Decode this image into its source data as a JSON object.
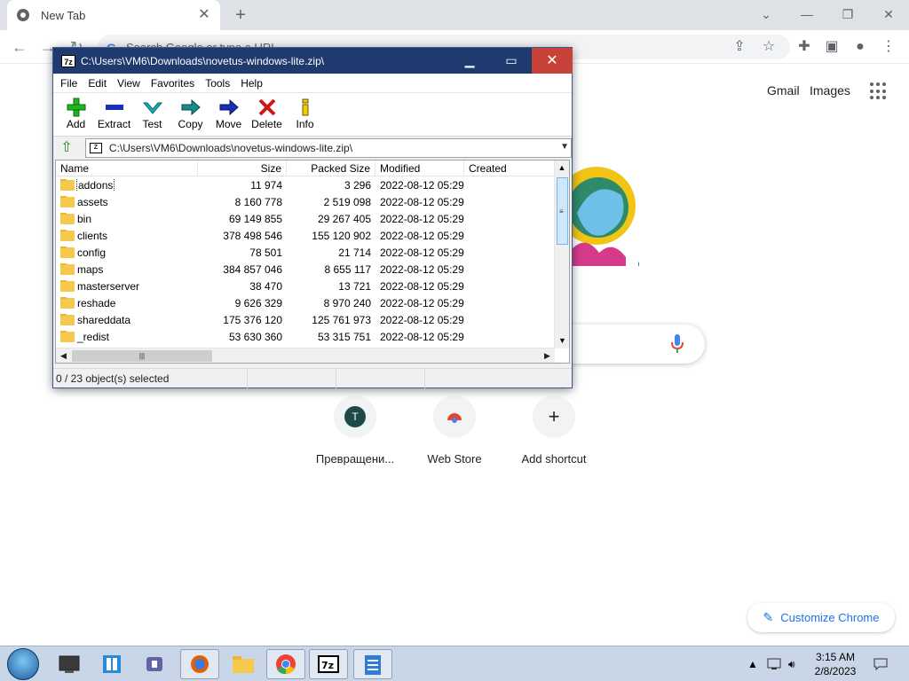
{
  "chrome": {
    "tab_title": "New Tab",
    "omnibox_placeholder": "Search Google or type a URL",
    "header_links": [
      "Gmail",
      "Images"
    ],
    "shortcuts": [
      {
        "label": "Превращени...",
        "initial": "T"
      },
      {
        "label": "Web Store"
      },
      {
        "label": "Add shortcut"
      }
    ],
    "customize_label": "Customize Chrome"
  },
  "zip": {
    "title": "C:\\Users\\VM6\\Downloads\\novetus-windows-lite.zip\\",
    "app_icon_text": "7z",
    "menu": [
      "File",
      "Edit",
      "View",
      "Favorites",
      "Tools",
      "Help"
    ],
    "toolbar": [
      {
        "label": "Add",
        "icon": "plus-icon",
        "color": "#1fb51f"
      },
      {
        "label": "Extract",
        "icon": "minus-icon",
        "color": "#1a2fb8"
      },
      {
        "label": "Test",
        "icon": "check-icon",
        "color": "#1ab0b8"
      },
      {
        "label": "Copy",
        "icon": "arrow-right-icon",
        "color": "#1a8a8a"
      },
      {
        "label": "Move",
        "icon": "arrow-right-icon",
        "color": "#1a2fb8"
      },
      {
        "label": "Delete",
        "icon": "x-icon",
        "color": "#d01818"
      },
      {
        "label": "Info",
        "icon": "info-icon",
        "color": "#c8a000"
      }
    ],
    "address": "C:\\Users\\VM6\\Downloads\\novetus-windows-lite.zip\\",
    "columns": [
      "Name",
      "Size",
      "Packed Size",
      "Modified",
      "Created"
    ],
    "rows": [
      {
        "name": "addons",
        "size": "11 974",
        "packed": "3 296",
        "modified": "2022-08-12 05:29",
        "created": ""
      },
      {
        "name": "assets",
        "size": "8 160 778",
        "packed": "2 519 098",
        "modified": "2022-08-12 05:29",
        "created": ""
      },
      {
        "name": "bin",
        "size": "69 149 855",
        "packed": "29 267 405",
        "modified": "2022-08-12 05:29",
        "created": ""
      },
      {
        "name": "clients",
        "size": "378 498 546",
        "packed": "155 120 902",
        "modified": "2022-08-12 05:29",
        "created": ""
      },
      {
        "name": "config",
        "size": "78 501",
        "packed": "21 714",
        "modified": "2022-08-12 05:29",
        "created": ""
      },
      {
        "name": "maps",
        "size": "384 857 046",
        "packed": "8 655 117",
        "modified": "2022-08-12 05:29",
        "created": ""
      },
      {
        "name": "masterserver",
        "size": "38 470",
        "packed": "13 721",
        "modified": "2022-08-12 05:29",
        "created": ""
      },
      {
        "name": "reshade",
        "size": "9 626 329",
        "packed": "8 970 240",
        "modified": "2022-08-12 05:29",
        "created": ""
      },
      {
        "name": "shareddata",
        "size": "175 376 120",
        "packed": "125 761 973",
        "modified": "2022-08-12 05:29",
        "created": ""
      },
      {
        "name": "_redist",
        "size": "53 630 360",
        "packed": "53 315 751",
        "modified": "2022-08-12 05:29",
        "created": ""
      }
    ],
    "status": "0 / 23 object(s) selected"
  },
  "taskbar": {
    "time": "3:15 AM",
    "date": "2/8/2023"
  }
}
